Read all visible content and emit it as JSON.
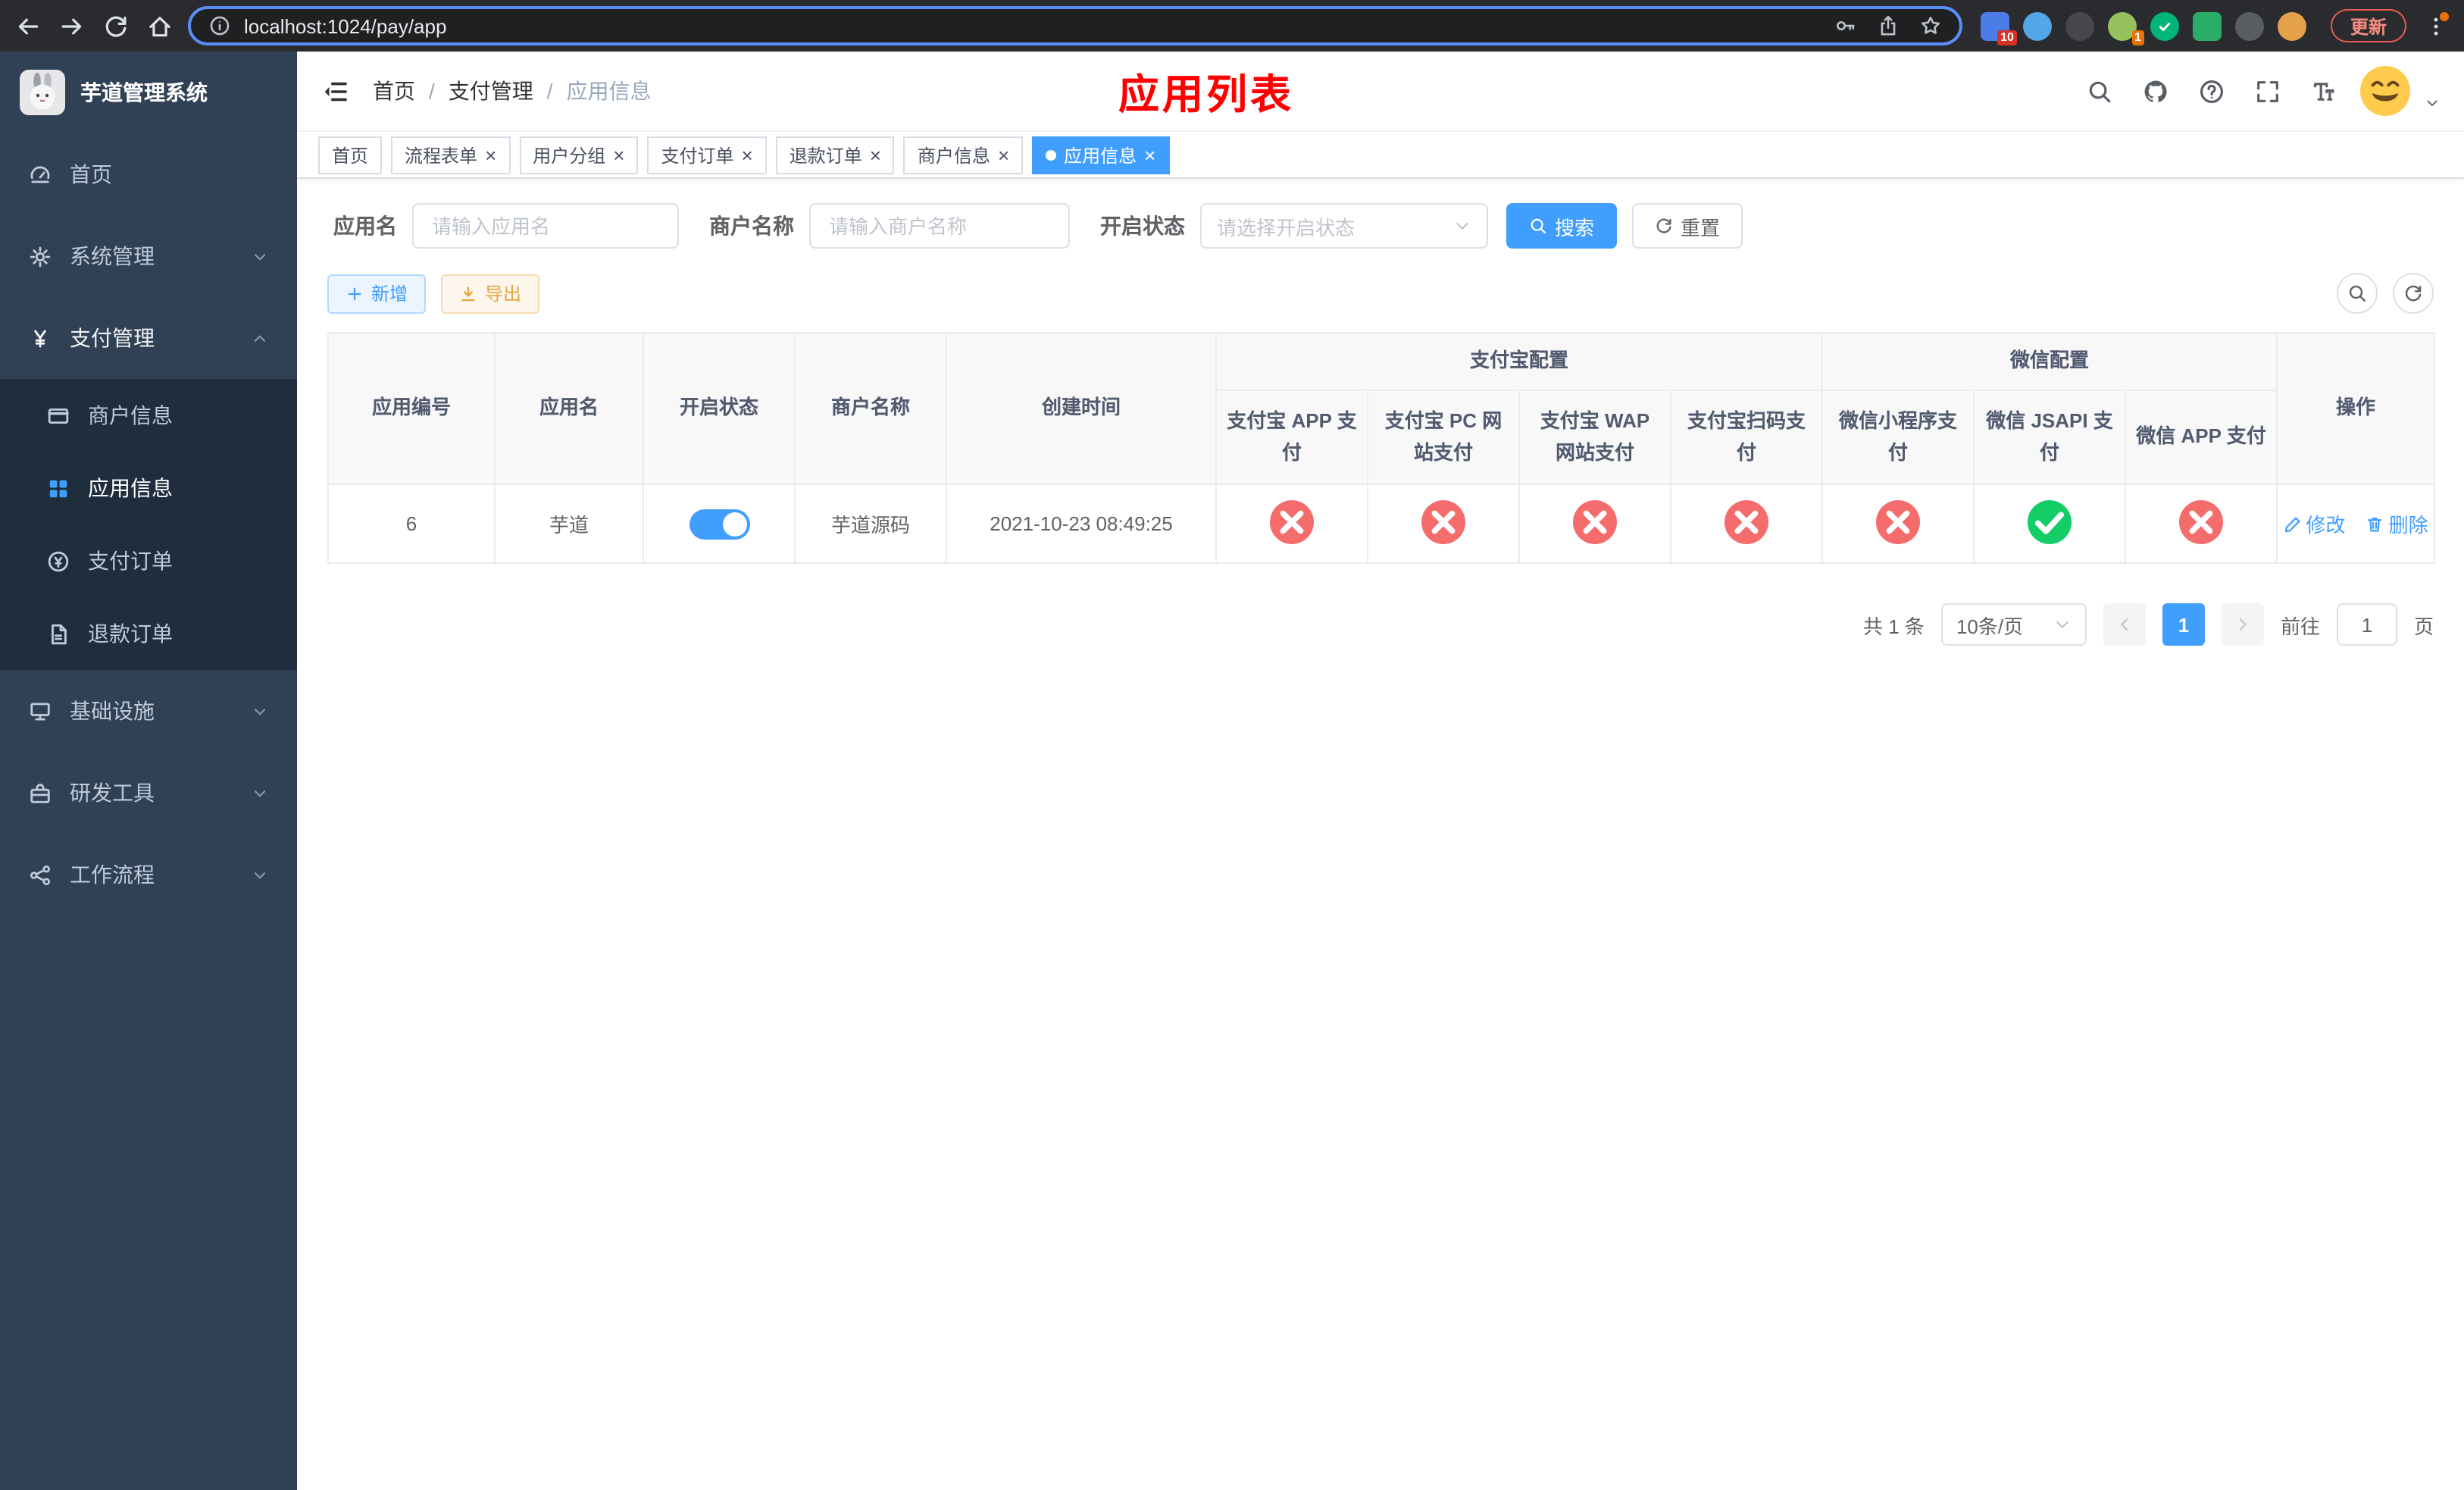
{
  "colors": {
    "primary": "#409eff",
    "danger": "#f56c6c",
    "success": "#13ce66",
    "warning": "#e6a23c",
    "title_red": "#ff0000",
    "sidebar_bg": "#304156",
    "submenu_bg": "#1f2d3d"
  },
  "browser": {
    "url": "localhost:1024/pay/app",
    "update_button": "更新",
    "nav": [
      {
        "id": "back",
        "icon": "arrow-left",
        "enabled": true
      },
      {
        "id": "forward",
        "icon": "arrow-right",
        "enabled": true
      },
      {
        "id": "reload",
        "icon": "refresh",
        "enabled": true
      },
      {
        "id": "home",
        "icon": "home",
        "enabled": true
      }
    ],
    "extensions": [
      {
        "id": "ext-colorful",
        "color": "#4b7be5",
        "shape": "square",
        "badge": "10",
        "badge_color": "#d93025"
      },
      {
        "id": "ext-drop",
        "color": "#53a7e8",
        "shape": "circle"
      },
      {
        "id": "ext-dark",
        "color": "#45474a",
        "shape": "circle"
      },
      {
        "id": "ext-avatar",
        "color": "#97c15c",
        "shape": "circle",
        "badge": "1",
        "badge_color": "#e8710a"
      },
      {
        "id": "ext-green-check",
        "color": "#00b578",
        "shape": "circle",
        "glyph": "check"
      },
      {
        "id": "ext-chat-green",
        "color": "#2aae67",
        "shape": "square"
      },
      {
        "id": "ext-pin-dark",
        "color": "#5a5d61",
        "shape": "circle"
      },
      {
        "id": "ext-monkey",
        "color": "#e5a04a",
        "shape": "circle"
      }
    ]
  },
  "sidebar": {
    "logo_title": "芋道管理系统",
    "items": [
      {
        "id": "home",
        "label": "首页",
        "icon": "dashboard",
        "expandable": false
      },
      {
        "id": "system",
        "label": "系统管理",
        "icon": "gear",
        "expandable": true,
        "expanded": false
      },
      {
        "id": "payment",
        "label": "支付管理",
        "icon": "yen",
        "expandable": true,
        "expanded": true,
        "active_parent": true,
        "children": [
          {
            "id": "merchant-info",
            "label": "商户信息",
            "icon": "card",
            "active": false
          },
          {
            "id": "app-info",
            "label": "应用信息",
            "icon": "grid",
            "active": true
          },
          {
            "id": "payment-order",
            "label": "支付订单",
            "icon": "order",
            "active": false
          },
          {
            "id": "refund-order",
            "label": "退款订单",
            "icon": "refund",
            "active": false
          }
        ]
      },
      {
        "id": "infrastructure",
        "label": "基础设施",
        "icon": "infra",
        "expandable": true,
        "expanded": false
      },
      {
        "id": "dev-tools",
        "label": "研发工具",
        "icon": "tools",
        "expandable": true,
        "expanded": false
      },
      {
        "id": "workflow",
        "label": "工作流程",
        "icon": "workflow",
        "expandable": true,
        "expanded": false
      }
    ]
  },
  "header": {
    "breadcrumb": [
      "首页",
      "支付管理",
      "应用信息"
    ],
    "breadcrumb_separator": "/",
    "page_title": "应用列表",
    "title_color": "#ff0000",
    "tools": [
      {
        "id": "header-search",
        "icon": "search"
      },
      {
        "id": "github",
        "icon": "github"
      },
      {
        "id": "help",
        "icon": "question"
      },
      {
        "id": "fullscreen",
        "icon": "fullscreen"
      },
      {
        "id": "font-size",
        "icon": "fontsize"
      }
    ]
  },
  "tabs": [
    {
      "id": "home",
      "label": "首页",
      "closable": false,
      "active": false
    },
    {
      "id": "process-form",
      "label": "流程表单",
      "closable": true,
      "active": false
    },
    {
      "id": "user-group",
      "label": "用户分组",
      "closable": true,
      "active": false
    },
    {
      "id": "pay-order",
      "label": "支付订单",
      "closable": true,
      "active": false
    },
    {
      "id": "refund-order",
      "label": "退款订单",
      "closable": true,
      "active": false
    },
    {
      "id": "merchant-info",
      "label": "商户信息",
      "closable": true,
      "active": false
    },
    {
      "id": "app-info",
      "label": "应用信息",
      "closable": true,
      "active": true
    }
  ],
  "filters": {
    "app_name_label": "应用名",
    "app_name_placeholder": "请输入应用名",
    "merchant_label": "商户名称",
    "merchant_placeholder": "请输入商户名称",
    "status_label": "开启状态",
    "status_placeholder": "请选择开启状态",
    "search_button": "搜索",
    "reset_button": "重置"
  },
  "toolbar": {
    "add_button": "新增",
    "export_button": "导出"
  },
  "table": {
    "left_columns": [
      "应用编号",
      "应用名",
      "开启状态",
      "商户名称",
      "创建时间"
    ],
    "alipay_group": {
      "label": "支付宝配置",
      "columns": [
        "支付宝 APP 支付",
        "支付宝 PC 网站支付",
        "支付宝 WAP 网站支付",
        "支付宝扫码支付"
      ]
    },
    "wechat_group": {
      "label": "微信配置",
      "columns": [
        "微信小程序支付",
        "微信 JSAPI 支付",
        "微信 APP 支付"
      ]
    },
    "ops_column": "操作",
    "rows": [
      {
        "app_id": "6",
        "app_name": "芋道",
        "enabled": true,
        "merchant_name": "芋道源码",
        "create_time": "2021-10-23 08:49:25",
        "channels": [
          false,
          false,
          false,
          false,
          false,
          true,
          false
        ],
        "actions": {
          "edit": "修改",
          "delete": "删除"
        }
      }
    ]
  },
  "pagination": {
    "total": "共 1 条",
    "page_size": "10条/页",
    "current_page": "1",
    "goto_prefix": "前往",
    "goto_value": "1",
    "goto_suffix": "页"
  }
}
